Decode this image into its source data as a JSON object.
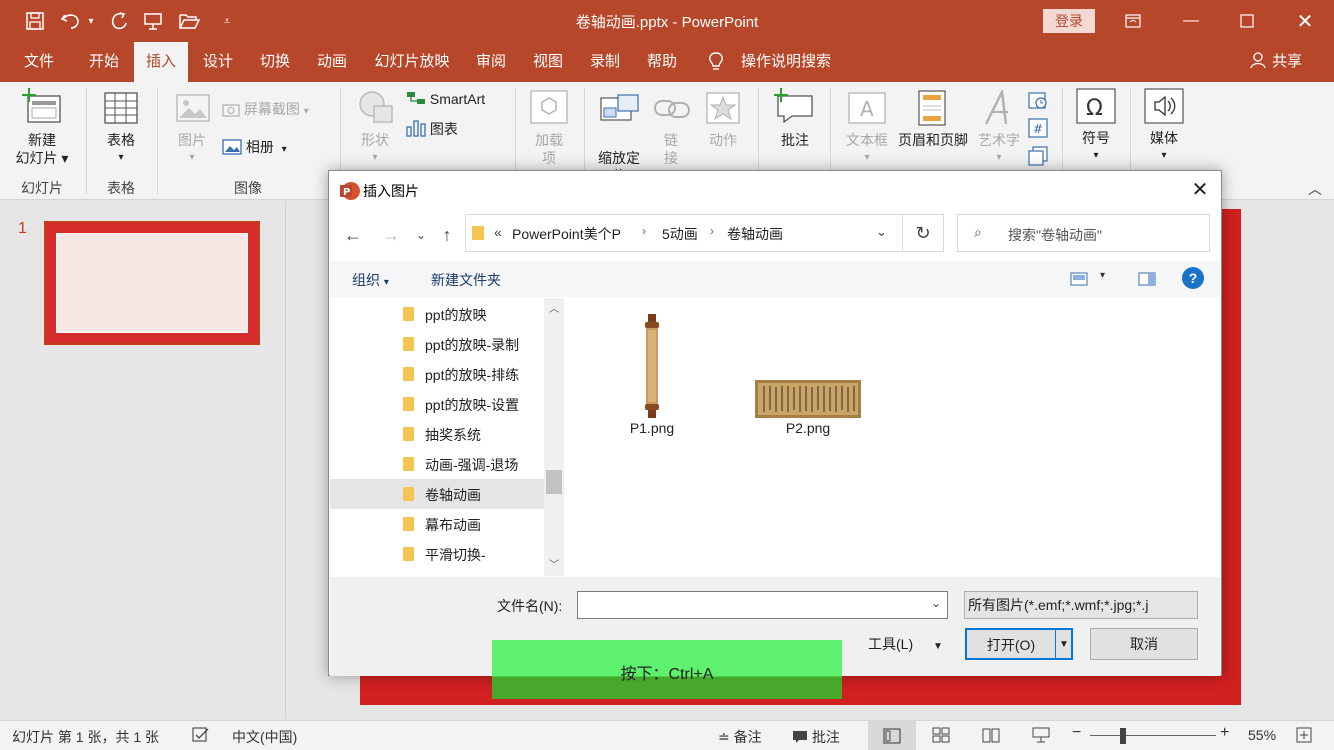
{
  "window": {
    "title": "卷轴动画.pptx  -  PowerPoint",
    "login_label": "登录",
    "share_label": "共享"
  },
  "colors": {
    "brand": "#b7472a",
    "slide_red": "#d0201f",
    "accent_blue": "#0078d7",
    "overlay_green": "#5cf070"
  },
  "quick_access_icons": [
    "save-icon",
    "undo-icon",
    "redo-icon",
    "present-icon",
    "open-folder-icon",
    "customize-icon"
  ],
  "menu": {
    "tabs": [
      "文件",
      "开始",
      "插入",
      "设计",
      "切换",
      "动画",
      "幻灯片放映",
      "审阅",
      "视图",
      "录制",
      "帮助"
    ],
    "active": "插入",
    "tell_me": "操作说明搜索"
  },
  "ribbon": {
    "new_slide": "新建\n幻灯片",
    "table": "表格",
    "picture": "图片",
    "screenshot": "屏幕截图",
    "album": "相册",
    "shapes": "形状",
    "smartart": "SmartArt",
    "chart": "图表",
    "addins": "加载\n项",
    "zoom": "缩放定\n位",
    "link": "链\n接",
    "action": "动作",
    "comment": "批注",
    "textbox": "文本框",
    "header_footer": "页眉和页脚",
    "wordart": "艺术字",
    "symbols": "符号",
    "media": "媒体",
    "groups": {
      "slides": "幻灯片",
      "tables": "表格",
      "images": "图像"
    }
  },
  "thumbnails": {
    "slide_number": "1"
  },
  "statusbar": {
    "slide_info": "幻灯片 第 1 张，共 1 张",
    "language": "中文(中国)",
    "notes": "备注",
    "comments": "批注",
    "zoom": "55%"
  },
  "dialog": {
    "title": "插入图片",
    "breadcrumb": [
      "«",
      "PowerPoint美个P",
      "5动画",
      "卷轴动画"
    ],
    "search_placeholder": "搜索\"卷轴动画\"",
    "organize": "组织",
    "new_folder": "新建文件夹",
    "help": "?",
    "folders": [
      "ppt的放映",
      "ppt的放映-录制",
      "ppt的放映-排练",
      "ppt的放映-设置",
      "抽奖系统",
      "动画-强调-退场",
      "卷轴动画",
      "幕布动画",
      "平滑切换-"
    ],
    "selected_folder": "卷轴动画",
    "files": [
      {
        "name": "P1.png"
      },
      {
        "name": "P2.png"
      }
    ],
    "filename_label": "文件名(N):",
    "filename_value": "",
    "filetype": "所有图片(*.emf;*.wmf;*.jpg;*.j",
    "tools": "工具(L)",
    "open": "打开(O)",
    "cancel": "取消"
  },
  "overlay": {
    "text": "按下：Ctrl+A"
  }
}
